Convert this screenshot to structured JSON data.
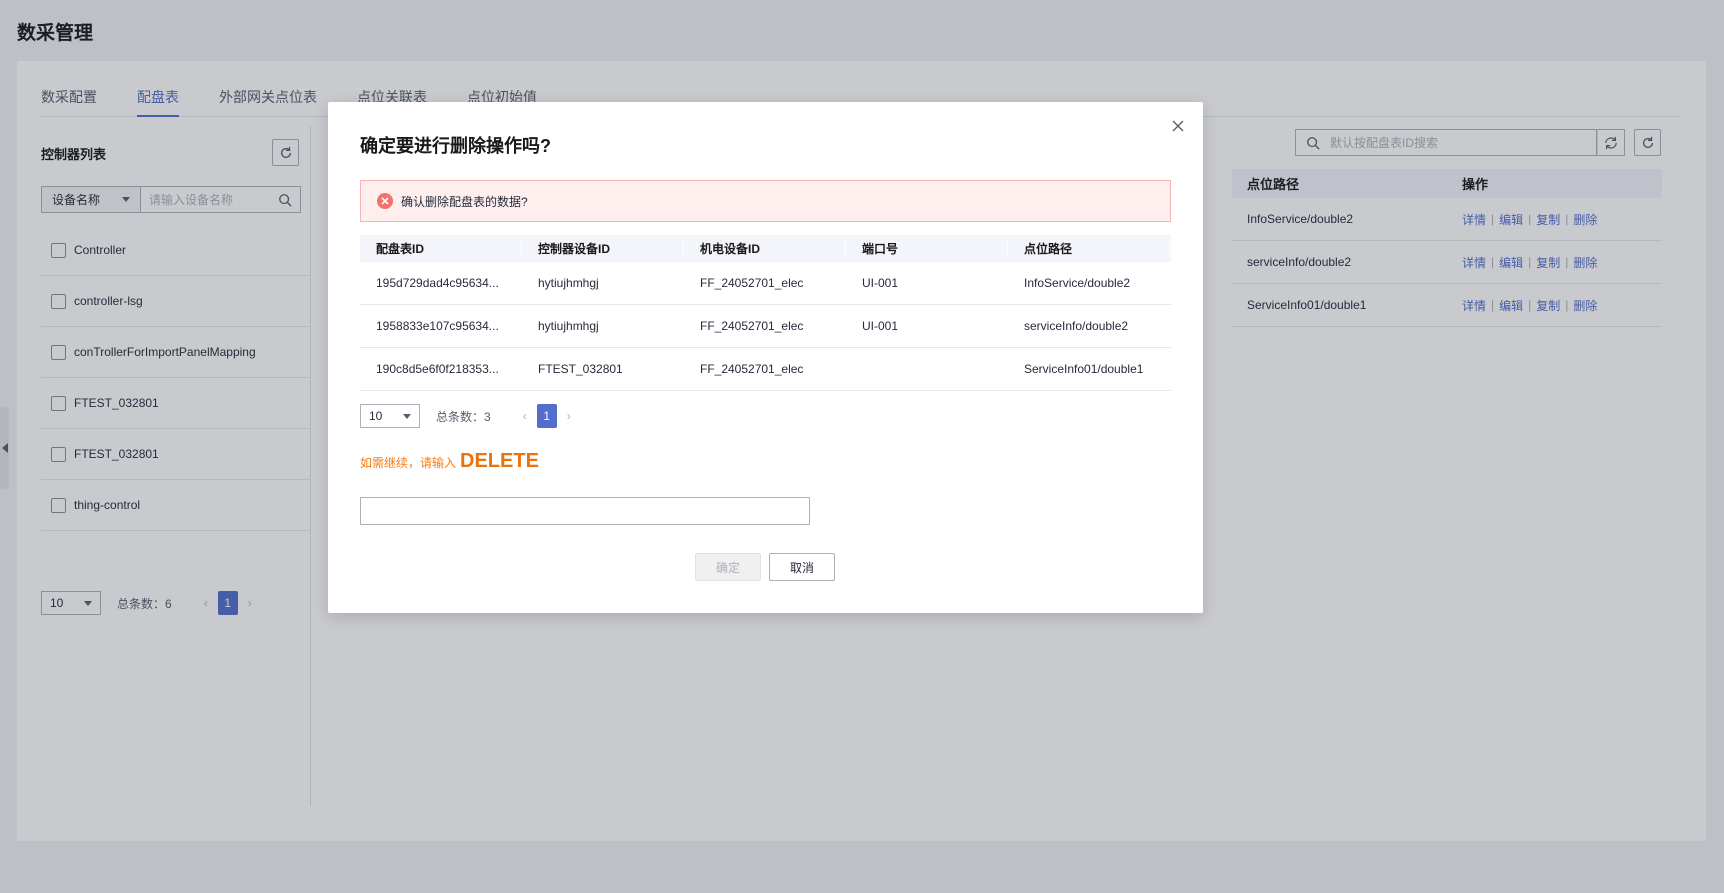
{
  "page": {
    "title": "数采管理"
  },
  "tabs": [
    {
      "label": "数采配置"
    },
    {
      "label": "配盘表"
    },
    {
      "label": "外部网关点位表"
    },
    {
      "label": "点位关联表"
    },
    {
      "label": "点位初始值"
    }
  ],
  "left_panel": {
    "title": "控制器列表",
    "filter_select": "设备名称",
    "filter_placeholder": "请输入设备名称",
    "items": [
      {
        "label": "Controller"
      },
      {
        "label": "controller-lsg"
      },
      {
        "label": "conTrollerForImportPanelMapping"
      },
      {
        "label": "FTEST_032801"
      },
      {
        "label": "FTEST_032801"
      },
      {
        "label": "thing-control"
      }
    ],
    "pager": {
      "size": "10",
      "total_label": "总条数：6",
      "page": "1"
    }
  },
  "right_panel": {
    "search_placeholder": "默认按配盘表ID搜索",
    "columns": [
      "点位路径",
      "操作"
    ],
    "rows": [
      {
        "path": "InfoService/double2"
      },
      {
        "path": "serviceInfo/double2"
      },
      {
        "path": "ServiceInfo01/double1"
      }
    ],
    "actions": {
      "detail": "详情",
      "edit": "编辑",
      "copy": "复制",
      "delete": "删除"
    }
  },
  "modal": {
    "title": "确定要进行删除操作吗?",
    "alert": "确认删除配盘表的数据?",
    "columns": [
      "配盘表ID",
      "控制器设备ID",
      "机电设备ID",
      "端口号",
      "点位路径"
    ],
    "rows": [
      [
        "195d729dad4c95634...",
        "hytiujhmhgj",
        "FF_24052701_elec",
        "UI-001",
        "InfoService/double2"
      ],
      [
        "1958833e107c95634...",
        "hytiujhmhgj",
        "FF_24052701_elec",
        "UI-001",
        "serviceInfo/double2"
      ],
      [
        "190c8d5e6f0f218353...",
        "FTEST_032801",
        "FF_24052701_elec",
        "",
        "ServiceInfo01/double1"
      ]
    ],
    "pager": {
      "size": "10",
      "total_label": "总条数：3",
      "page": "1"
    },
    "hint_prefix": "如需继续，请输入",
    "hint_keyword": "DELETE",
    "input_value": "",
    "confirm_label": "确定",
    "cancel_label": "取消"
  },
  "colors": {
    "accent": "#526ecc",
    "danger": "#f66f6a",
    "warning": "#fa7b0f"
  }
}
